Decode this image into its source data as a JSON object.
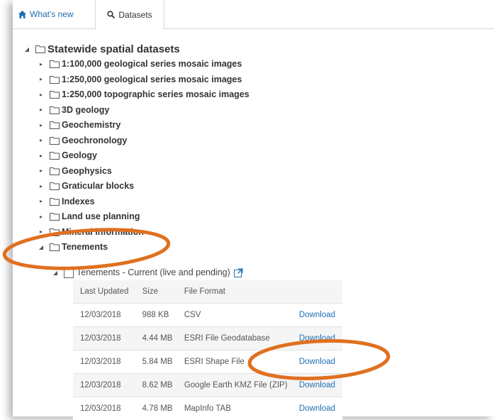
{
  "tabs": [
    {
      "label": "What's new",
      "icon": "home-icon"
    },
    {
      "label": "Datasets",
      "icon": "search-icon",
      "active": true
    }
  ],
  "tree": {
    "root": "Statewide spatial datasets",
    "folders": [
      "1:100,000 geological series mosaic images",
      "1:250,000 geological series mosaic images",
      "1:250,000 topographic series mosaic images",
      "3D geology",
      "Geochemistry",
      "Geochronology",
      "Geology",
      "Geophysics",
      "Graticular blocks",
      "Indexes",
      "Land use planning",
      "Mineral information",
      "Tenements"
    ],
    "file": "Tenements - Current (live and pending)"
  },
  "table": {
    "headers": [
      "Last Updated",
      "Size",
      "File Format",
      ""
    ],
    "rows": [
      {
        "date": "12/03/2018",
        "size": "988 KB",
        "format": "CSV",
        "action": "Download"
      },
      {
        "date": "12/03/2018",
        "size": "4.44 MB",
        "format": "ESRI File Geodatabase",
        "action": "Download"
      },
      {
        "date": "12/03/2018",
        "size": "5.84 MB",
        "format": "ESRI Shape File",
        "action": "Download"
      },
      {
        "date": "12/03/2018",
        "size": "8.62 MB",
        "format": "Google Earth KMZ File (ZIP)",
        "action": "Download"
      },
      {
        "date": "12/03/2018",
        "size": "4.78 MB",
        "format": "MapInfo TAB",
        "action": "Download"
      }
    ]
  },
  "colors": {
    "link": "#1f6fb2",
    "annotation": "#e07020"
  }
}
